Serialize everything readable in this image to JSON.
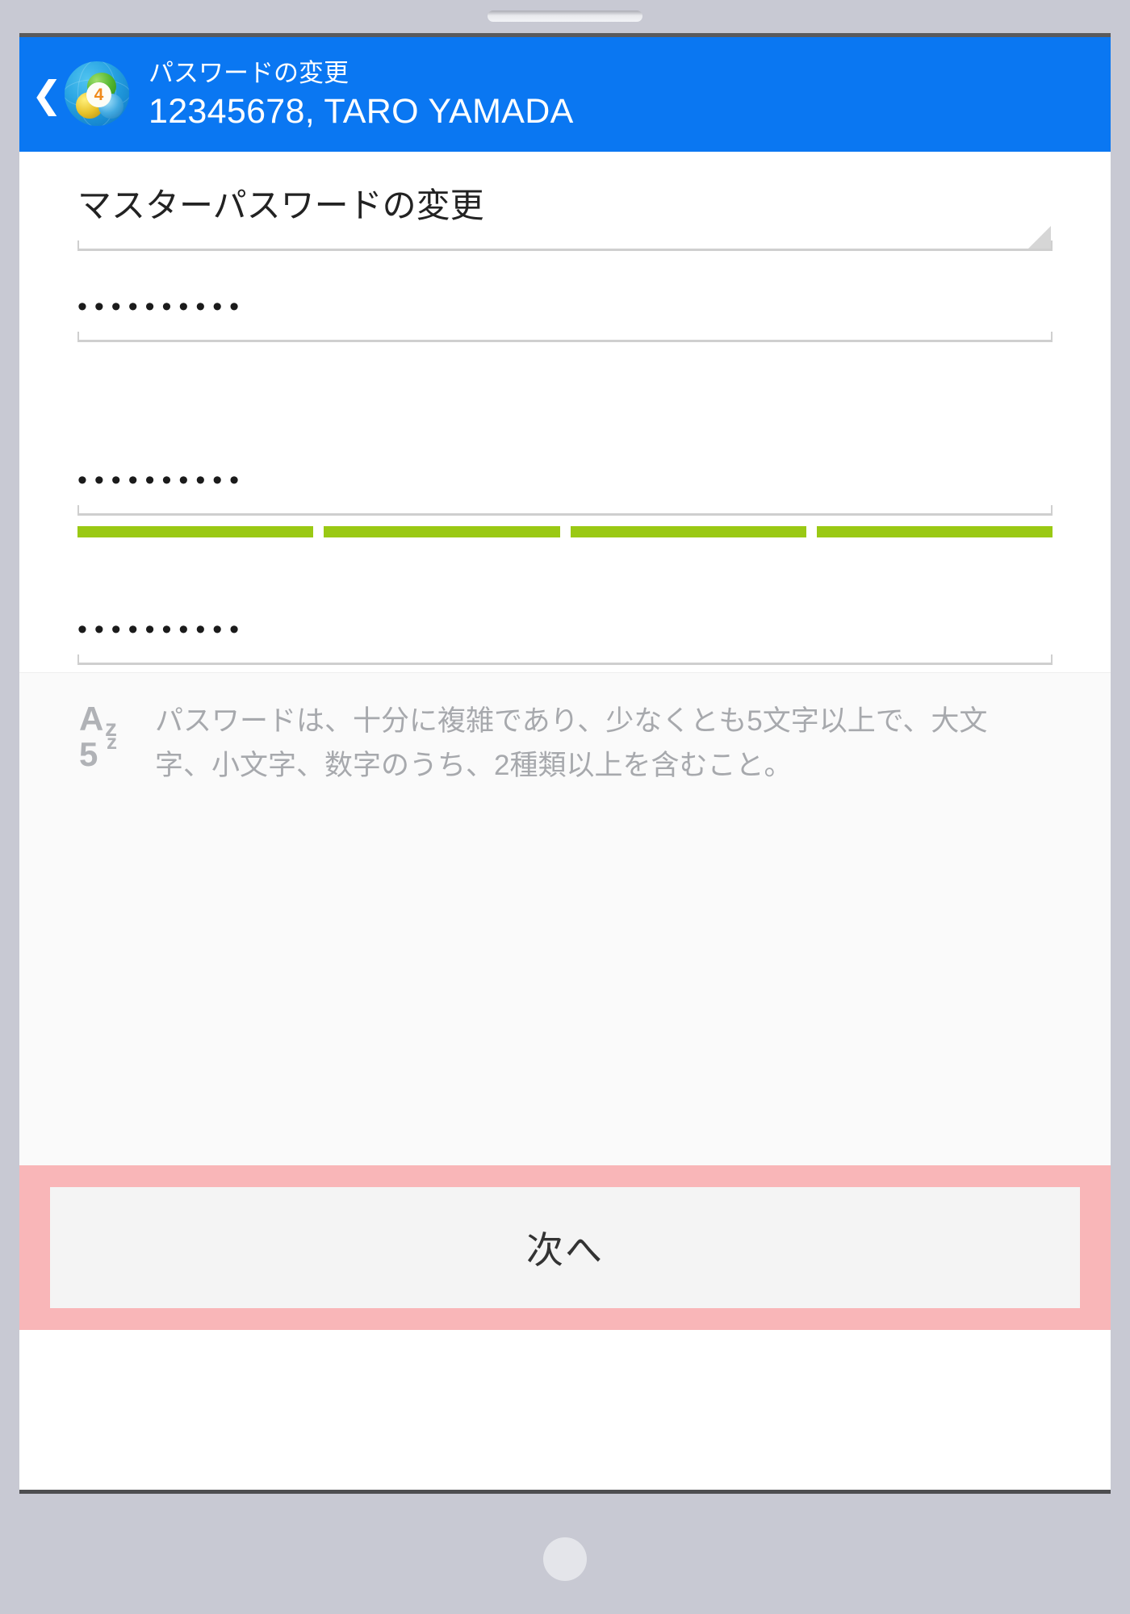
{
  "app_bar": {
    "back_icon": "back-chevron-icon",
    "app_icon": "metatrader-app-icon",
    "app_icon_badge": "4",
    "subtitle": "パスワードの変更",
    "title": "12345678, TARO YAMADA",
    "background_color": "#0a77f2"
  },
  "form": {
    "password_type_select": {
      "value": "マスターパスワードの変更",
      "caret_icon": "dropdown-corner-caret-icon"
    },
    "current_password": {
      "value": "••••••••••",
      "masked_char_count": 10
    },
    "new_password": {
      "value": "••••••••••",
      "masked_char_count": 10
    },
    "confirm_password": {
      "value": "••••••••••",
      "masked_char_count": 10
    },
    "strength_meter": {
      "segments": 4,
      "filled": 4,
      "fill_color": "#9ac914",
      "empty_color": "#e3e3e3"
    }
  },
  "hint": {
    "icon": "alphanumeric-case-icon",
    "icon_glyphs": {
      "upper": "A",
      "lower": "z",
      "digit": "5",
      "lower2": "z"
    },
    "text": "パスワードは、十分に複雑であり、少なくとも5文字以上で、大文字、小文字、数字のうち、2種類以上を含むこと。"
  },
  "footer": {
    "next_label": "次へ",
    "highlight_color": "#f9b6b8",
    "button_color": "#f4f4f4"
  }
}
